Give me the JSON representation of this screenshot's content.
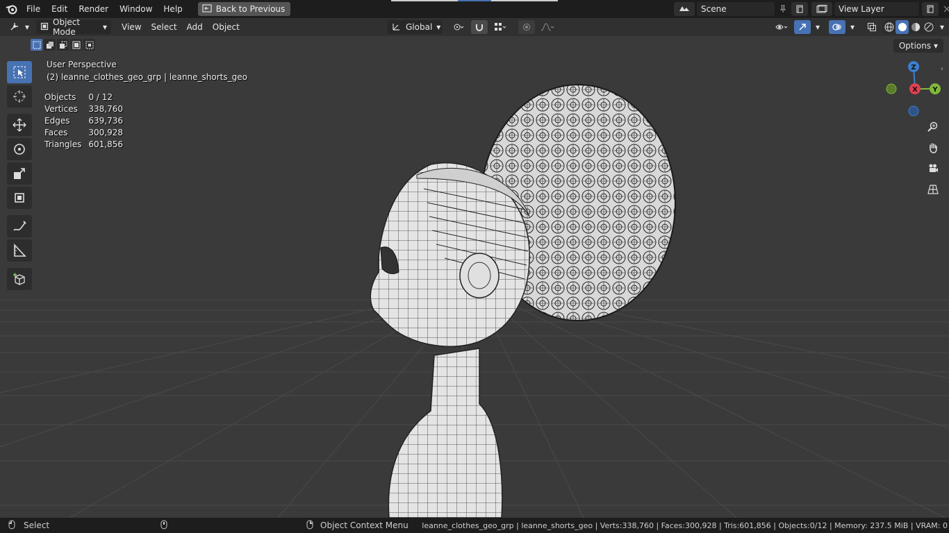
{
  "menu": {
    "file": "File",
    "edit": "Edit",
    "render": "Render",
    "window": "Window",
    "help": "Help",
    "back_to_previous": "Back to Previous"
  },
  "scene": {
    "name": "Scene",
    "view_layer": "View Layer"
  },
  "header": {
    "mode": "Object Mode",
    "view": "View",
    "select": "Select",
    "add": "Add",
    "object": "Object",
    "orientation": "Global",
    "options": "Options"
  },
  "viewport": {
    "perspective": "User Perspective",
    "active_object": "(2) leanne_clothes_geo_grp | leanne_shorts_geo",
    "stats": [
      {
        "label": "Objects",
        "value": "0 / 12"
      },
      {
        "label": "Vertices",
        "value": "338,760"
      },
      {
        "label": "Edges",
        "value": "639,736"
      },
      {
        "label": "Faces",
        "value": "300,928"
      },
      {
        "label": "Triangles",
        "value": "601,856"
      }
    ],
    "gizmo": {
      "z": "Z",
      "x": "X",
      "y": "Y"
    }
  },
  "status": {
    "select": "Select",
    "context_menu": "Object Context Menu",
    "info": "leanne_clothes_geo_grp | leanne_shorts_geo | Verts:338,760 | Faces:300,928 | Tris:601,856 | Objects:0/12 | Memory: 237.5 MiB | VRAM: 0"
  },
  "colors": {
    "accent": "#4772b3",
    "axis_x": "#e0414f",
    "axis_y": "#80b838",
    "axis_z": "#3b7fcf"
  }
}
